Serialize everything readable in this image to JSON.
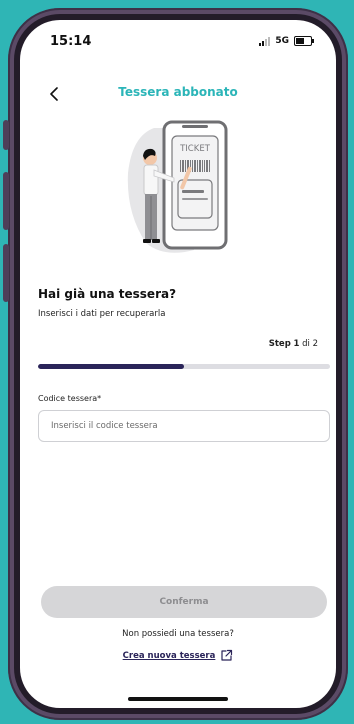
{
  "status_bar": {
    "time": "15:14",
    "network": "5G"
  },
  "header": {
    "title": "Tessera abbonato"
  },
  "illustration": {
    "ticket_label": "TICKET"
  },
  "content": {
    "heading": "Hai già una tessera?",
    "subheading": "Inserisci i dati per recuperarla",
    "step_label": "Step",
    "step_current": "1",
    "step_total_text": "di 2",
    "progress_fraction": 0.5
  },
  "form": {
    "card_code_label": "Codice tessera*",
    "card_code_placeholder": "Inserisci il codice tessera",
    "card_code_value": ""
  },
  "actions": {
    "confirm_label": "Conferma",
    "no_card_text": "Non possiedi una tessera?",
    "create_card_label": "Crea nuova tessera"
  },
  "colors": {
    "accent": "#2bb5b8",
    "primary_dark": "#2a2459",
    "disabled_button": "#d6d6d8",
    "background": "#2fb5b5"
  }
}
